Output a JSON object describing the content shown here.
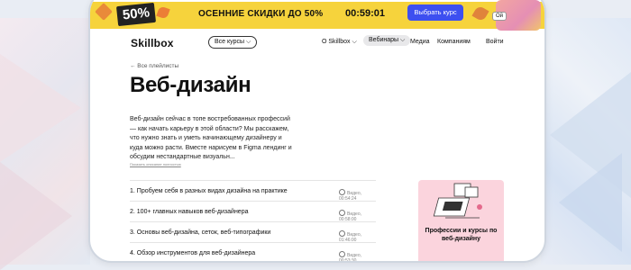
{
  "promo": {
    "badge": "50%",
    "text": "ОСЕННИЕ СКИДКИ ДО 50%",
    "timer": "00:59:01",
    "button": "Выбрать курс",
    "tag": "Ой"
  },
  "nav": {
    "logo": "Skillbox",
    "all_courses": "Все курсы",
    "about": "О Skillbox",
    "webinars": "Вебинары",
    "media": "Медиа",
    "companies": "Компаниям",
    "login": "Войти"
  },
  "page": {
    "back": "← Все плейлисты",
    "title": "Веб-дизайн",
    "description": "Веб-дизайн сейчас в топе востребованных профессий — как начать карьеру в этой области? Мы расскажем, что нужно знать и уметь начинающему дизайнеру и куда можно расти. Вместе нарисуем в Figma лендинг и обсудим нестандартные визуальн...",
    "more": "Показать описание полностью"
  },
  "lessons": [
    {
      "title": "1.   Пробуем себя в разных видах дизайна на практике",
      "meta": "Видео, 00:54:24"
    },
    {
      "title": "2.   100+ главных навыков веб-дизайнера",
      "meta": "Видео, 00:58:00"
    },
    {
      "title": "3.   Основы веб-дизайна, сеток, веб-типографики",
      "meta": "Видео, 01:46:00"
    },
    {
      "title": "4.   Обзор инструментов для веб-дизайнера",
      "meta": "Видео, 00:53:30"
    }
  ],
  "card": {
    "title": "Профессии и курсы по веб-дизайну"
  },
  "colors": {
    "promo_bg": "#f6d33c",
    "accent": "#3d4ff0",
    "card_bg": "#fbd4dd"
  }
}
